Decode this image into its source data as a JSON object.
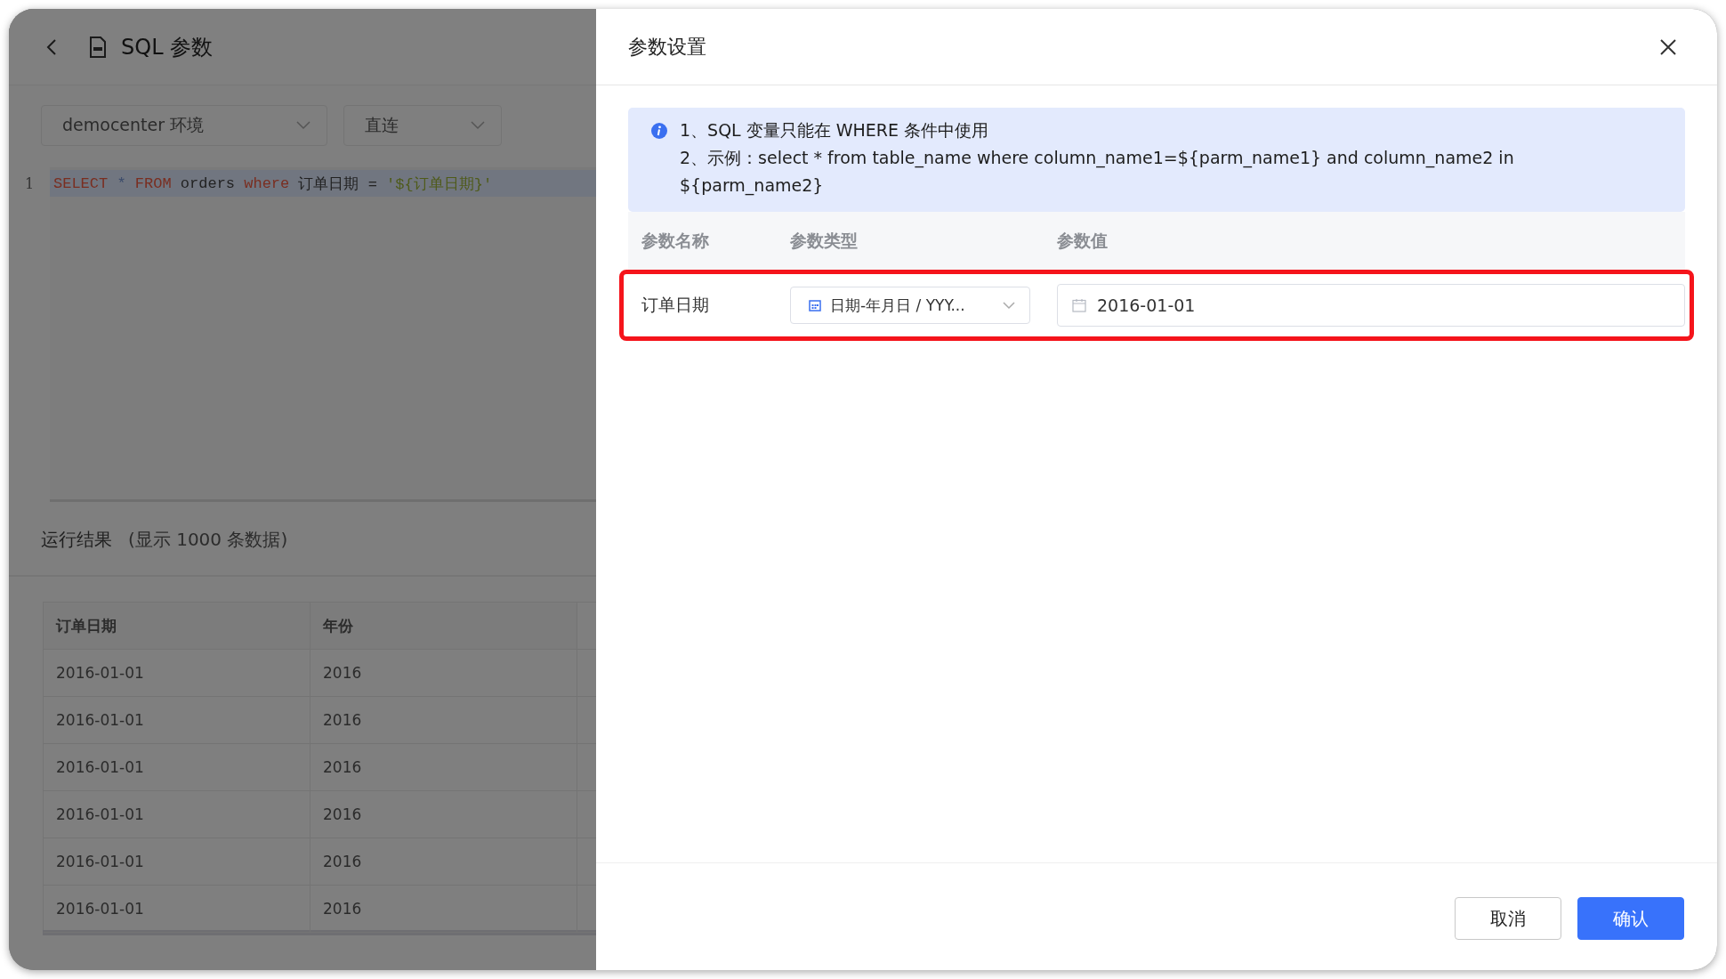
{
  "page": {
    "title": "SQL 参数",
    "environment_select": "democenter 环境",
    "connection_select": "直连",
    "code_lines": [
      {
        "number": "1",
        "tokens": [
          {
            "kind": "keyword",
            "text": "SELECT"
          },
          {
            "kind": "operator",
            "text": " * "
          },
          {
            "kind": "keyword",
            "text": "FROM"
          },
          {
            "kind": "plain",
            "text": " orders "
          },
          {
            "kind": "keyword",
            "text": "where"
          },
          {
            "kind": "plain",
            "text": " 订单日期 = "
          },
          {
            "kind": "string",
            "text": "'${订单日期}'"
          }
        ]
      }
    ],
    "results_title": "运行结果",
    "results_note": "(显示 1000 条数据)",
    "table": {
      "columns": [
        "订单日期",
        "年份"
      ],
      "rows": [
        [
          "2016-01-01",
          "2016"
        ],
        [
          "2016-01-01",
          "2016"
        ],
        [
          "2016-01-01",
          "2016"
        ],
        [
          "2016-01-01",
          "2016"
        ],
        [
          "2016-01-01",
          "2016"
        ],
        [
          "2016-01-01",
          "2016"
        ]
      ]
    }
  },
  "dialog": {
    "title": "参数设置",
    "info_lines": [
      "1、SQL 变量只能在 WHERE 条件中使用",
      "2、示例：select * from table_name where column_name1=${parm_name1} and column_name2 in ${parm_name2}"
    ],
    "columns": [
      "参数名称",
      "参数类型",
      "参数值"
    ],
    "params": [
      {
        "name": "订单日期",
        "type": "日期-年月日 / YYY...",
        "value": "2016-01-01",
        "highlighted": true
      }
    ],
    "buttons": [
      {
        "label": "取消",
        "kind": "secondary"
      },
      {
        "label": "确认",
        "kind": "primary"
      }
    ]
  }
}
